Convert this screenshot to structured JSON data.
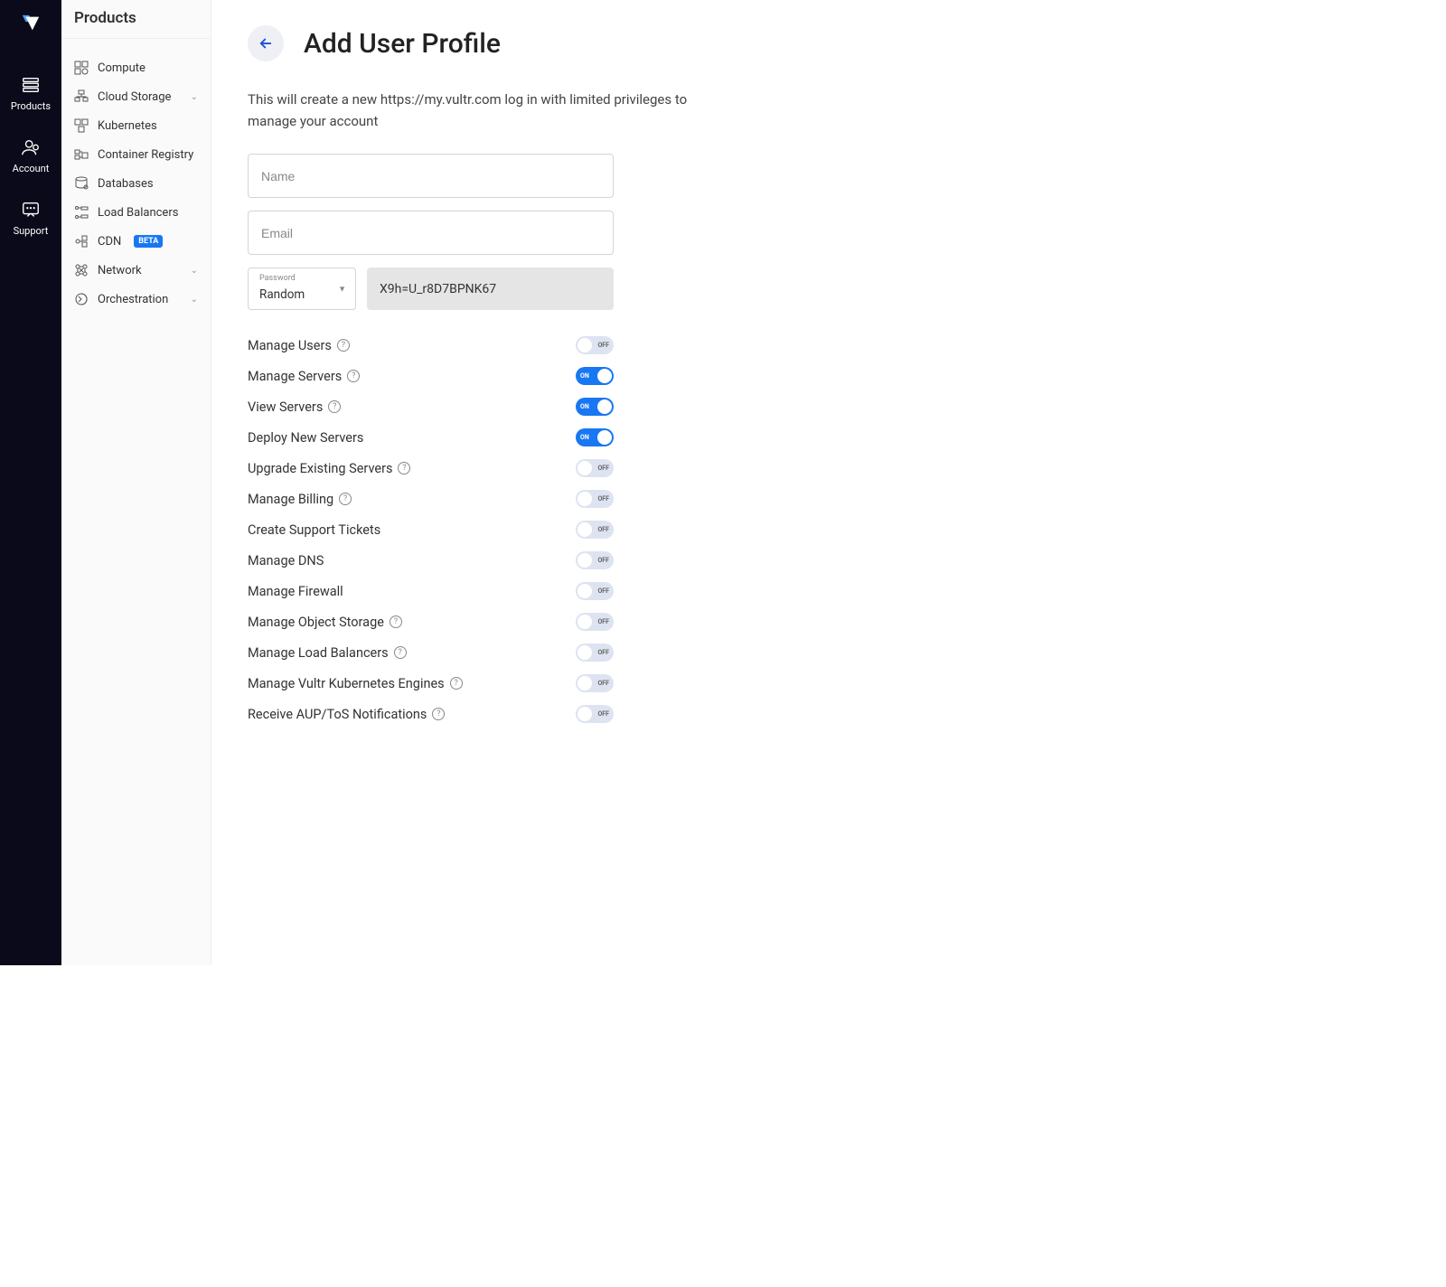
{
  "rail": {
    "items": [
      {
        "label": "Products"
      },
      {
        "label": "Account"
      },
      {
        "label": "Support"
      }
    ]
  },
  "sidebar": {
    "title": "Products",
    "items": [
      {
        "label": "Compute",
        "expandable": false
      },
      {
        "label": "Cloud Storage",
        "expandable": true
      },
      {
        "label": "Kubernetes",
        "expandable": false
      },
      {
        "label": "Container Registry",
        "expandable": false
      },
      {
        "label": "Databases",
        "expandable": false
      },
      {
        "label": "Load Balancers",
        "expandable": false
      },
      {
        "label": "CDN",
        "expandable": false,
        "badge": "BETA"
      },
      {
        "label": "Network",
        "expandable": true
      },
      {
        "label": "Orchestration",
        "expandable": true
      }
    ]
  },
  "page": {
    "title": "Add User Profile",
    "description": "This will create a new https://my.vultr.com log in with limited privileges to manage your account",
    "name_placeholder": "Name",
    "email_placeholder": "Email",
    "password_label": "Password",
    "password_mode": "Random",
    "password_value": "X9h=U_r8D7BPNK67"
  },
  "permissions": [
    {
      "label": "Manage Users",
      "help": true,
      "on": false
    },
    {
      "label": "Manage Servers",
      "help": true,
      "on": true
    },
    {
      "label": "View Servers",
      "help": true,
      "on": true
    },
    {
      "label": "Deploy New Servers",
      "help": false,
      "on": true
    },
    {
      "label": "Upgrade Existing Servers",
      "help": true,
      "on": false
    },
    {
      "label": "Manage Billing",
      "help": true,
      "on": false
    },
    {
      "label": "Create Support Tickets",
      "help": false,
      "on": false
    },
    {
      "label": "Manage DNS",
      "help": false,
      "on": false
    },
    {
      "label": "Manage Firewall",
      "help": false,
      "on": false
    },
    {
      "label": "Manage Object Storage",
      "help": true,
      "on": false
    },
    {
      "label": "Manage Load Balancers",
      "help": true,
      "on": false
    },
    {
      "label": "Manage Vultr Kubernetes Engines",
      "help": true,
      "on": false
    },
    {
      "label": "Receive AUP/ToS Notifications",
      "help": true,
      "on": false
    }
  ],
  "toggle_text": {
    "on": "ON",
    "off": "OFF"
  }
}
